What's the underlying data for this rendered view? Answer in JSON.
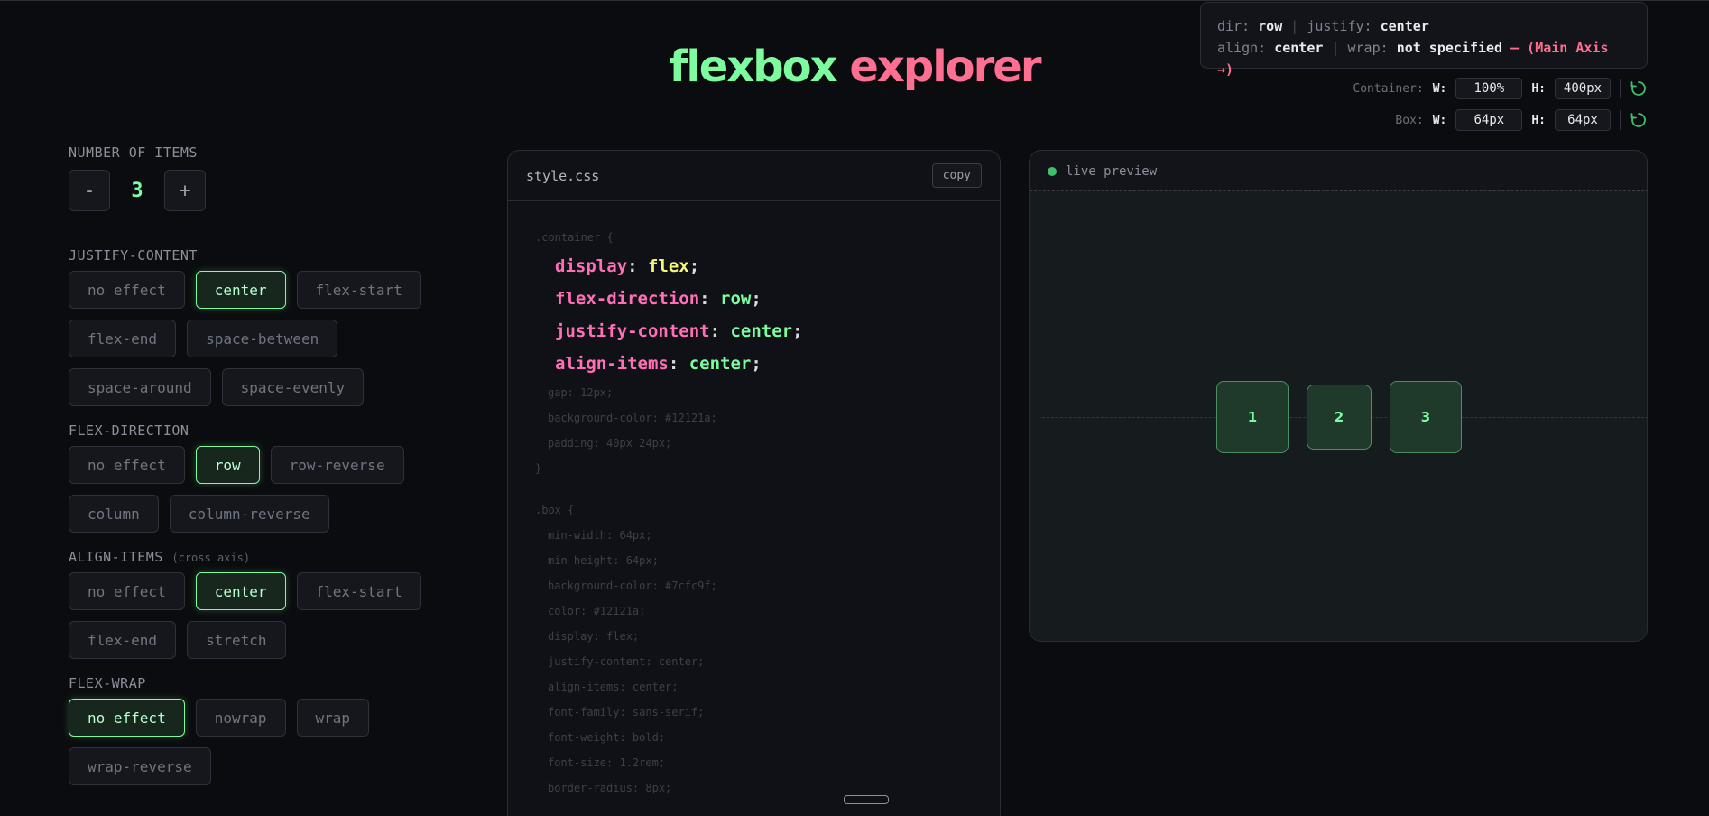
{
  "title": {
    "part1": "flexbox",
    "part2": "explorer"
  },
  "status": {
    "dir_label": "dir:",
    "dir_value": "row",
    "sep": "|",
    "justify_label": "justify:",
    "justify_value": "center",
    "align_label": "align:",
    "align_value": "center",
    "wrap_label": "wrap:",
    "wrap_value": "not specified",
    "axis_note": "— (Main Axis →)"
  },
  "container_dims": {
    "label": "Container:",
    "w_label": "W:",
    "w_value": "100%",
    "h_label": "H:",
    "h_value": "400px"
  },
  "box_dims": {
    "label": "Box:",
    "w_label": "W:",
    "w_value": "64px",
    "h_label": "H:",
    "h_value": "64px"
  },
  "controls": {
    "items": {
      "label": "NUMBER OF ITEMS",
      "minus": "-",
      "count": "3",
      "plus": "+"
    },
    "justify": {
      "label": "JUSTIFY-CONTENT",
      "options": [
        "no effect",
        "center",
        "flex-start",
        "flex-end",
        "space-between",
        "space-around",
        "space-evenly"
      ],
      "active": "center"
    },
    "direction": {
      "label": "FLEX-DIRECTION",
      "options": [
        "no effect",
        "row",
        "row-reverse",
        "column",
        "column-reverse"
      ],
      "active": "row"
    },
    "align": {
      "label": "ALIGN-ITEMS",
      "note": "(cross axis)",
      "options": [
        "no effect",
        "center",
        "flex-start",
        "flex-end",
        "stretch"
      ],
      "active": "center"
    },
    "wrap": {
      "label": "FLEX-WRAP",
      "options": [
        "no effect",
        "nowrap",
        "wrap",
        "wrap-reverse"
      ],
      "active": "no effect"
    }
  },
  "code": {
    "filename": "style.css",
    "copy_label": "copy",
    "container_open": ".container {",
    "hl": [
      {
        "prop": "display",
        "value": "flex"
      },
      {
        "prop": "flex-direction",
        "value": "row"
      },
      {
        "prop": "justify-content",
        "value": "center"
      },
      {
        "prop": "align-items",
        "value": "center"
      }
    ],
    "container_rest": [
      "gap: 12px;",
      "background-color: #12121a;",
      "padding: 40px 24px;"
    ],
    "close": "}",
    "box_open": ".box {",
    "box_lines": [
      "min-width: 64px;",
      "min-height: 64px;",
      "background-color: #7cfc9f;",
      "color: #12121a;",
      "display: flex;",
      "justify-content: center;",
      "align-items: center;",
      "font-family: sans-serif;",
      "font-weight: bold;",
      "font-size: 1.2rem;",
      "border-radius: 8px;"
    ]
  },
  "preview": {
    "label": "live preview",
    "boxes": [
      "1",
      "2",
      "3"
    ]
  },
  "colors": {
    "accent_green": "#7cfc9f",
    "accent_pink": "#ff6f91",
    "bg": "#0b0c0f"
  }
}
